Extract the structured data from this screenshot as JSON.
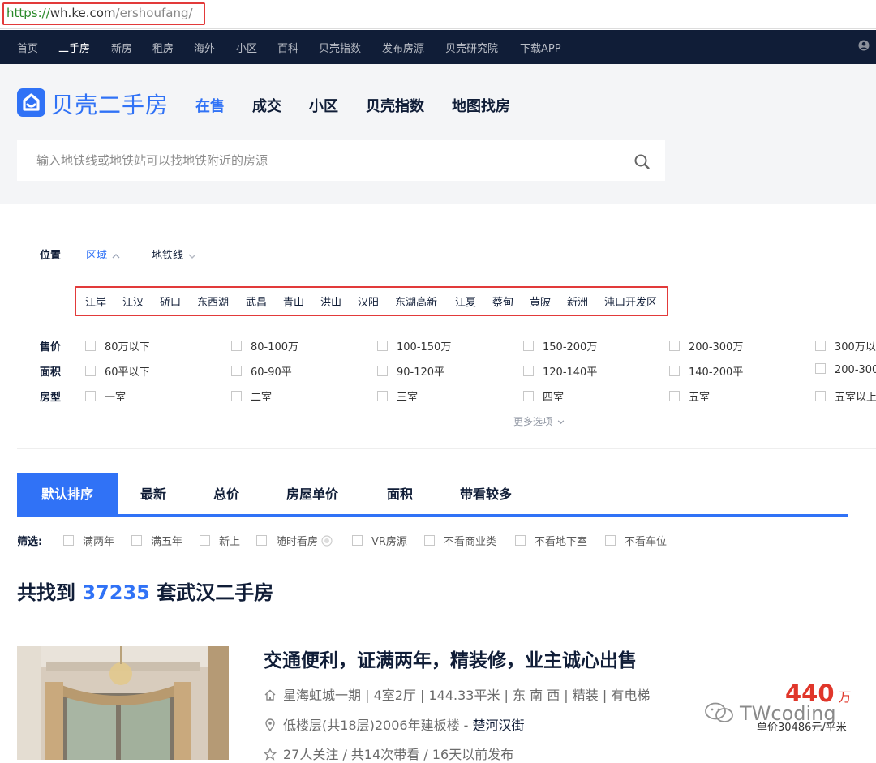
{
  "url": {
    "scheme": "https://",
    "host": "wh.ke.com",
    "path": "/ershoufang/",
    "highlight_color": "#e23a3a"
  },
  "topnav": {
    "items": [
      "首页",
      "二手房",
      "新房",
      "租房",
      "海外",
      "小区",
      "百科",
      "贝壳指数",
      "发布房源",
      "贝壳研究院",
      "下载APP"
    ],
    "active_index": 1,
    "bg_color": "#101d37"
  },
  "header": {
    "logo_text": "贝壳二手房",
    "tabs": [
      "在售",
      "成交",
      "小区",
      "贝壳指数",
      "地图找房"
    ],
    "active_tab": 0,
    "search_placeholder": "输入地铁线或地铁站可以找地铁附近的房源",
    "brand_color": "#3072f6"
  },
  "filters": {
    "position_label": "位置",
    "area_label": "区域",
    "subway_label": "地铁线",
    "districts": [
      "江岸",
      "江汉",
      "硚口",
      "东西湖",
      "武昌",
      "青山",
      "洪山",
      "汉阳",
      "东湖高新",
      "江夏",
      "蔡甸",
      "黄陂",
      "新洲",
      "沌口开发区"
    ],
    "price_label": "售价",
    "price_options": [
      "80万以下",
      "80-100万",
      "100-150万",
      "150-200万",
      "200-300万",
      "300万以"
    ],
    "area_size_label": "面积",
    "area_size_options": [
      "60平以下",
      "60-90平",
      "90-120平",
      "120-140平",
      "140-200平",
      "200-300"
    ],
    "room_label": "房型",
    "room_options": [
      "一室",
      "二室",
      "三室",
      "四室",
      "五室",
      "五室以上"
    ],
    "more_options": "更多选项"
  },
  "sort": {
    "tabs": [
      "默认排序",
      "最新",
      "总价",
      "房屋单价",
      "面积",
      "带看较多"
    ],
    "active_tab": 0
  },
  "screen": {
    "label": "筛选:",
    "options": [
      "满两年",
      "满五年",
      "新上",
      "随时看房",
      "VR房源",
      "不看商业类",
      "不看地下室",
      "不看车位"
    ]
  },
  "result": {
    "prefix": "共找到",
    "count": "37235",
    "suffix": "套武汉二手房"
  },
  "listing": {
    "title": "交通便利，证满两年，精装修，业主诚心出售",
    "house_info": "星海虹城一期 | 4室2厅 | 144.33平米 | 东 南 西 | 精装 | 有电梯",
    "position_info": "低楼层(共18层)2006年建板楼 - ",
    "position_link": "楚河汉街",
    "follow_info": "27人关注 / 共14次带看 / 16天以前发布",
    "total_price": "440",
    "price_unit": "万",
    "unit_price": "单价30486元/平米",
    "price_color": "#e0362a",
    "watermark": "TWcoding",
    "icons": [
      "home-icon",
      "location-pin-icon",
      "star-icon"
    ]
  }
}
